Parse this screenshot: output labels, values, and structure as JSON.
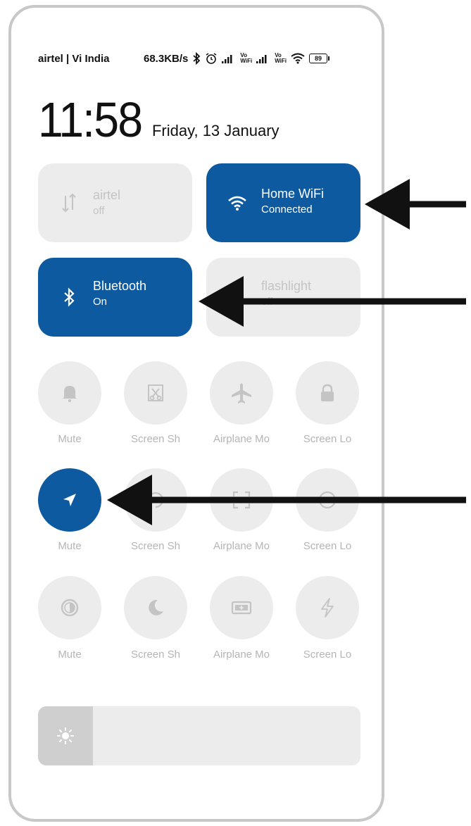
{
  "status_bar": {
    "carrier": "airtel | Vi India",
    "speed": "68.3KB/s",
    "vo_label": "Vo",
    "wifi_label": "WiFi",
    "battery": "89"
  },
  "clock": {
    "time": "11:58",
    "date": "Friday, 13 January"
  },
  "tiles": [
    {
      "name": "airtel",
      "state": "off",
      "icon": "mobile-data-icon",
      "active": false
    },
    {
      "name": "Home WiFi",
      "state": "Connected",
      "icon": "wifi-icon",
      "active": true
    },
    {
      "name": "Bluetooth",
      "state": "On",
      "icon": "bluetooth-icon",
      "active": true
    },
    {
      "name": "flashlight",
      "state": "off",
      "icon": "flashlight-icon",
      "active": false
    }
  ],
  "grid": [
    {
      "label": "Mute",
      "icon": "bell-icon",
      "active": false
    },
    {
      "label": "Screen Sh",
      "icon": "screenshot-icon",
      "active": false
    },
    {
      "label": "Airplane Mo",
      "icon": "airplane-icon",
      "active": false
    },
    {
      "label": "Screen Lo",
      "icon": "lock-icon",
      "active": false
    },
    {
      "label": "Mute",
      "icon": "location-icon",
      "active": true
    },
    {
      "label": "Screen Sh",
      "icon": "rotate-icon",
      "active": false
    },
    {
      "label": "Airplane Mo",
      "icon": "scan-icon",
      "active": false
    },
    {
      "label": "Screen Lo",
      "icon": "eye-icon",
      "active": false
    },
    {
      "label": "Mute",
      "icon": "invert-colors-icon",
      "active": false
    },
    {
      "label": "Screen Sh",
      "icon": "dark-mode-icon",
      "active": false
    },
    {
      "label": "Airplane Mo",
      "icon": "battery-saver-icon",
      "active": false
    },
    {
      "label": "Screen Lo",
      "icon": "flash-icon",
      "active": false
    }
  ],
  "brightness": {
    "level_percent": 17,
    "icon": "sun-icon"
  },
  "colors": {
    "accent": "#0d5aa1",
    "tile_off": "#ececec",
    "label_off": "#b5b5b5",
    "arrow": "#111111"
  }
}
